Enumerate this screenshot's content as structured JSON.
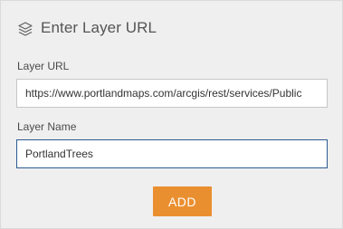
{
  "header": {
    "icon": "layers-icon",
    "title": "Enter Layer URL"
  },
  "form": {
    "layer_url": {
      "label": "Layer URL",
      "value": "https://www.portlandmaps.com/arcgis/rest/services/Public"
    },
    "layer_name": {
      "label": "Layer Name",
      "value": "PortlandTrees"
    },
    "add_button_label": "ADD"
  },
  "colors": {
    "panel_background": "#efefef",
    "add_button": "#ea8f30",
    "focused_input_border": "#2c5b8f"
  }
}
